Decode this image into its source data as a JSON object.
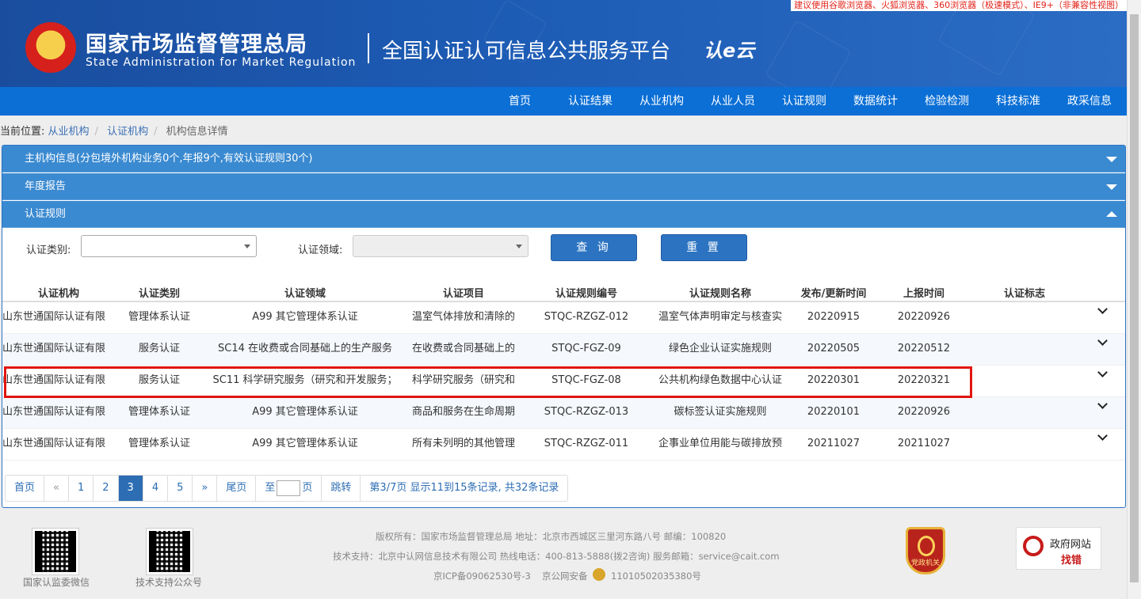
{
  "header": {
    "browser_tip": "建议使用谷歌浏览器、火狐浏览器、360浏览器（极速模式）、IE9+（非兼容性视图）",
    "agency_cn": "国家市场监督管理总局",
    "agency_en": "State Administration  for  Market Regulation",
    "platform": "全国认证认可信息公共服务平台",
    "logo_text": "认e云"
  },
  "nav": [
    "首页",
    "认证结果",
    "从业机构",
    "从业人员",
    "认证规则",
    "数据统计",
    "检验检测",
    "科技标准",
    "政采信息"
  ],
  "breadcrumb": {
    "label": "当前位置:",
    "items": [
      "从业机构",
      "认证机构",
      "机构信息详情"
    ]
  },
  "accordion": [
    {
      "title": "主机构信息(分包境外机构业务0个,年报9个,有效认证规则30个)",
      "state": "collapsed"
    },
    {
      "title": "年度报告",
      "state": "collapsed"
    },
    {
      "title": "认证规则",
      "state": "expanded"
    }
  ],
  "filters": {
    "type_label": "认证类别:",
    "field_label": "认证领域:",
    "search_button": "查 询",
    "reset_button": "重 置"
  },
  "table": {
    "headers": [
      "认证机构",
      "认证类别",
      "认证领域",
      "认证项目",
      "认证规则编号",
      "认证规则名称",
      "发布/更新时间",
      "上报时间",
      "认证标志"
    ],
    "rows": [
      [
        "山东世通国际认证有限",
        "管理体系认证",
        "A99 其它管理体系认证",
        "温室气体排放和清除的",
        "STQC-RZGZ-012",
        "温室气体声明审定与核查实",
        "20220915",
        "20220926",
        ""
      ],
      [
        "山东世通国际认证有限",
        "服务认证",
        "SC14 在收费或合同基础上的生产服务",
        "在收费或合同基础上的",
        "STQC-FGZ-09",
        "绿色企业认证实施规则",
        "20220505",
        "20220512",
        ""
      ],
      [
        "山东世通国际认证有限",
        "服务认证",
        "SC11 科学研究服务（研究和开发服务；",
        "科学研究服务（研究和",
        "STQC-FGZ-08",
        "公共机构绿色数据中心认证",
        "20220301",
        "20220321",
        ""
      ],
      [
        "山东世通国际认证有限",
        "管理体系认证",
        "A99 其它管理体系认证",
        "商品和服务在生命周期",
        "STQC-RZGZ-013",
        "碳标签认证实施规则",
        "20220101",
        "20220926",
        ""
      ],
      [
        "山东世通国际认证有限",
        "管理体系认证",
        "A99 其它管理体系认证",
        "所有未列明的其他管理",
        "STQC-RZGZ-011",
        "企事业单位用能与碳排放预",
        "20211027",
        "20211027",
        ""
      ]
    ],
    "highlighted_row_index": 2
  },
  "pagination": {
    "first": "首页",
    "prev": "«",
    "pages": [
      "1",
      "2",
      "3",
      "4",
      "5"
    ],
    "current": "3",
    "next": "»",
    "last": "尾页",
    "goto_prefix": "至",
    "goto_suffix": "页",
    "jump": "跳转",
    "summary": "第3/7页  显示11到15条记录, 共32条记录"
  },
  "footer": {
    "qr1_caption": "国家认监委微信",
    "qr2_caption": "技术支持公众号",
    "line1": "版权所有：国家市场监督管理总局    地址：北京市西城区三里河东路八号    邮编：100820",
    "line2": "技术支持：北京中认网信息技术有限公司    热线电话：400-813-5888(拨2咨询)    服务邮箱：service@cait.com",
    "line3_icp": "京ICP备09062530号-3",
    "line3_police": "京公网安备",
    "line3_police_no": "11010502035380号",
    "badge_text": "党政机关",
    "error_title": "政府网站",
    "error_sub": "找错"
  },
  "colors": {
    "header": "#1d5cb5",
    "nav": "#0b6fd6",
    "accordion": "#3a8ad1",
    "button": "#2c74c2",
    "highlight": "#e1150f"
  }
}
